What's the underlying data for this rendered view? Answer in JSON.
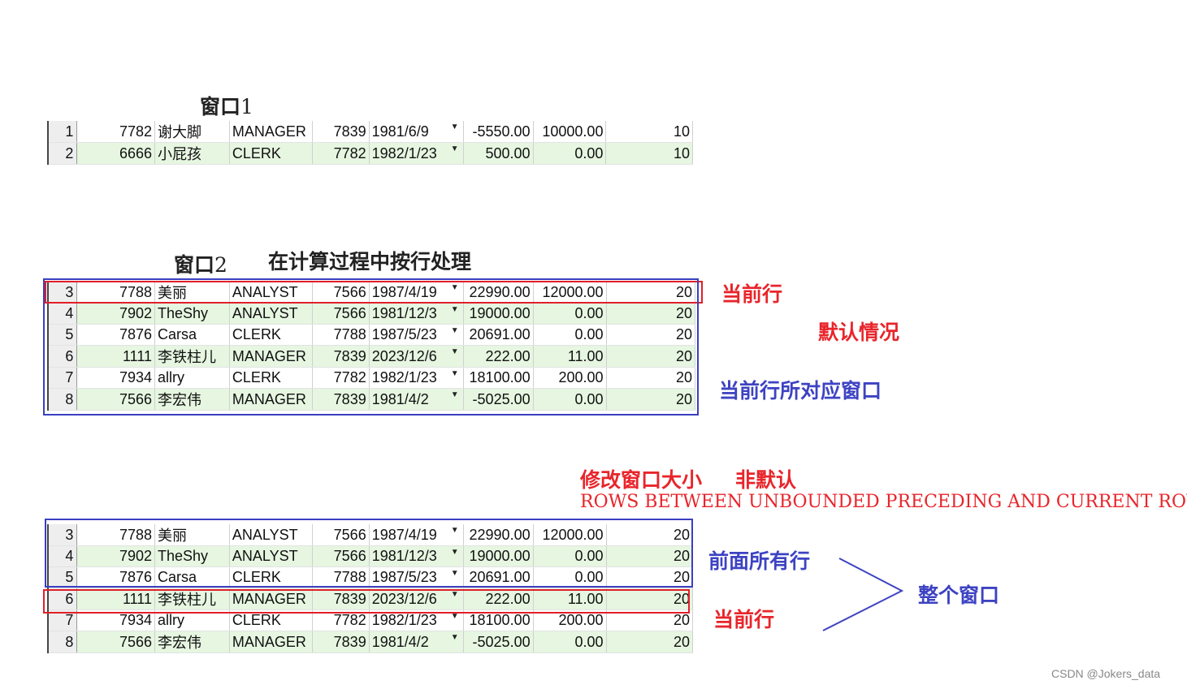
{
  "titles": {
    "window1": "窗口",
    "window1_num": "1",
    "window2": "窗口",
    "window2_num": "2",
    "process_note": "在计算过程中按行处理"
  },
  "annotations": {
    "current_row_1": "当前行",
    "default_case": "默认情况",
    "current_row_window": "当前行所对应窗口",
    "modify_window": "修改窗口大小",
    "non_default": "非默认",
    "rows_clause": "ROWS BETWEEN  UNBOUNDED PRECEDING AND CURRENT ROWS",
    "all_previous_rows": "前面所有行",
    "whole_window": "整个窗口",
    "current_row_2": "当前行"
  },
  "watermark": "CSDN @Jokers_data",
  "colors": {
    "red": "#e8252b",
    "blue": "#3d43c2",
    "row_green": "#e6f6e1"
  },
  "table1": {
    "rows": [
      {
        "rn": "1",
        "empno": "7782",
        "ename": "谢大脚",
        "job": "MANAGER",
        "mgr": "7839",
        "date": "1981/6/9",
        "v1": "-5550.00",
        "v2": "10000.00",
        "dept": "10"
      },
      {
        "rn": "2",
        "empno": "6666",
        "ename": "小屁孩",
        "job": "CLERK",
        "mgr": "7782",
        "date": "1982/1/23",
        "v1": "500.00",
        "v2": "0.00",
        "dept": "10"
      }
    ]
  },
  "table2": {
    "rows": [
      {
        "rn": "3",
        "empno": "7788",
        "ename": "美丽",
        "job": "ANALYST",
        "mgr": "7566",
        "date": "1987/4/19",
        "v1": "22990.00",
        "v2": "12000.00",
        "dept": "20"
      },
      {
        "rn": "4",
        "empno": "7902",
        "ename": "TheShy",
        "job": "ANALYST",
        "mgr": "7566",
        "date": "1981/12/3",
        "v1": "19000.00",
        "v2": "0.00",
        "dept": "20"
      },
      {
        "rn": "5",
        "empno": "7876",
        "ename": "Carsa",
        "job": "CLERK",
        "mgr": "7788",
        "date": "1987/5/23",
        "v1": "20691.00",
        "v2": "0.00",
        "dept": "20"
      },
      {
        "rn": "6",
        "empno": "1111",
        "ename": "李铁柱儿",
        "job": "MANAGER",
        "mgr": "7839",
        "date": "2023/12/6",
        "v1": "222.00",
        "v2": "11.00",
        "dept": "20"
      },
      {
        "rn": "7",
        "empno": "7934",
        "ename": "allry",
        "job": "CLERK",
        "mgr": "7782",
        "date": "1982/1/23",
        "v1": "18100.00",
        "v2": "200.00",
        "dept": "20"
      },
      {
        "rn": "8",
        "empno": "7566",
        "ename": "李宏伟",
        "job": "MANAGER",
        "mgr": "7839",
        "date": "1981/4/2",
        "v1": "-5025.00",
        "v2": "0.00",
        "dept": "20"
      }
    ]
  },
  "table3": {
    "rows": [
      {
        "rn": "3",
        "empno": "7788",
        "ename": "美丽",
        "job": "ANALYST",
        "mgr": "7566",
        "date": "1987/4/19",
        "v1": "22990.00",
        "v2": "12000.00",
        "dept": "20"
      },
      {
        "rn": "4",
        "empno": "7902",
        "ename": "TheShy",
        "job": "ANALYST",
        "mgr": "7566",
        "date": "1981/12/3",
        "v1": "19000.00",
        "v2": "0.00",
        "dept": "20"
      },
      {
        "rn": "5",
        "empno": "7876",
        "ename": "Carsa",
        "job": "CLERK",
        "mgr": "7788",
        "date": "1987/5/23",
        "v1": "20691.00",
        "v2": "0.00",
        "dept": "20"
      },
      {
        "rn": "6",
        "empno": "1111",
        "ename": "李铁柱儿",
        "job": "MANAGER",
        "mgr": "7839",
        "date": "2023/12/6",
        "v1": "222.00",
        "v2": "11.00",
        "dept": "20"
      },
      {
        "rn": "7",
        "empno": "7934",
        "ename": "allry",
        "job": "CLERK",
        "mgr": "7782",
        "date": "1982/1/23",
        "v1": "18100.00",
        "v2": "200.00",
        "dept": "20"
      },
      {
        "rn": "8",
        "empno": "7566",
        "ename": "李宏伟",
        "job": "MANAGER",
        "mgr": "7839",
        "date": "1981/4/2",
        "v1": "-5025.00",
        "v2": "0.00",
        "dept": "20"
      }
    ]
  }
}
